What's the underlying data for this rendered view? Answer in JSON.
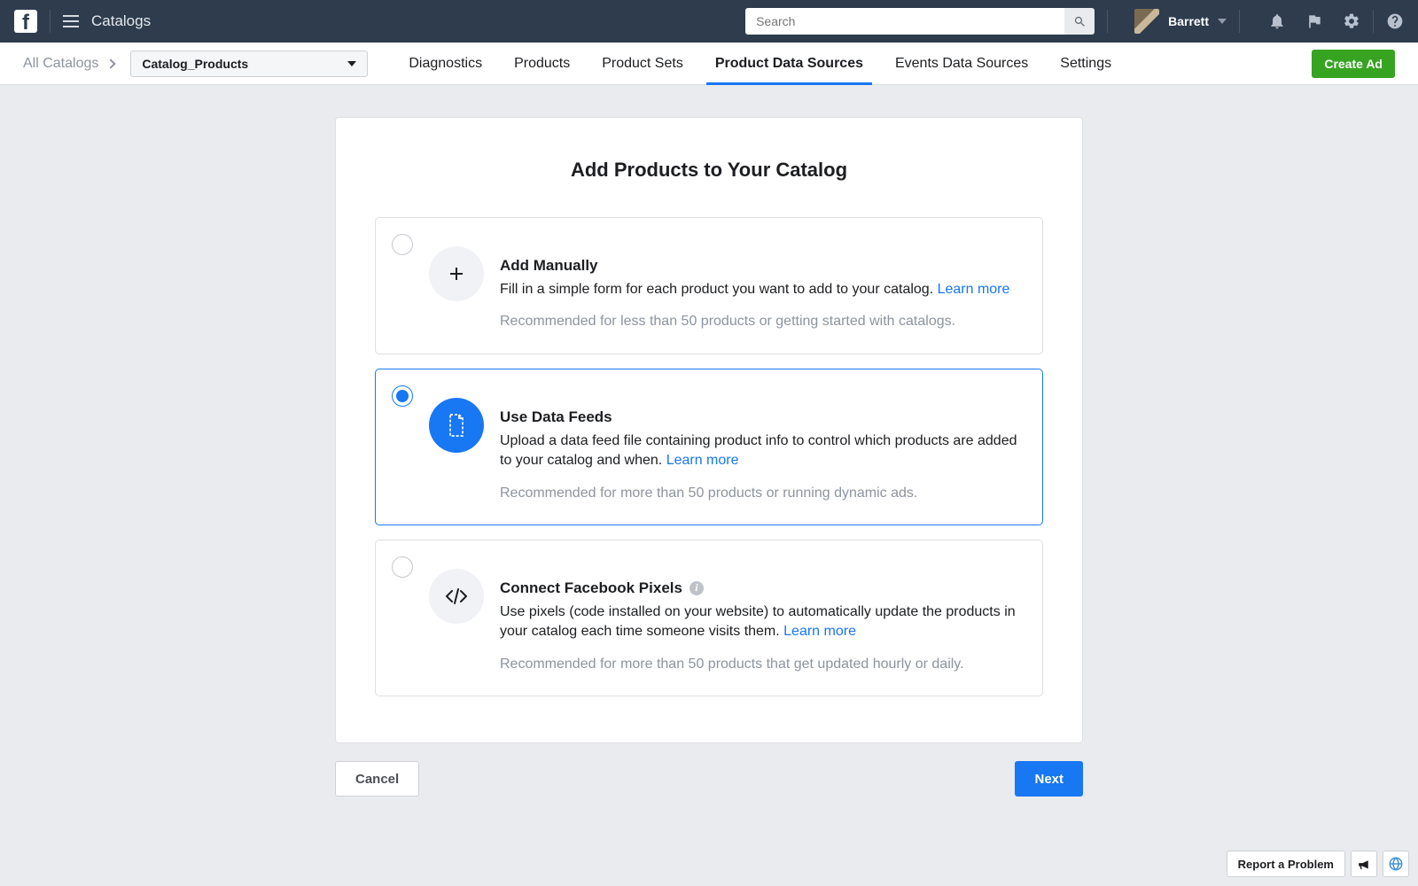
{
  "topbar": {
    "app_title": "Catalogs",
    "search_placeholder": "Search",
    "user_name": "Barrett"
  },
  "subnav": {
    "crumb": "All Catalogs",
    "catalog_selected": "Catalog_Products",
    "tabs": [
      "Diagnostics",
      "Products",
      "Product Sets",
      "Product Data Sources",
      "Events Data Sources",
      "Settings"
    ],
    "active_tab_index": 3,
    "create_ad": "Create Ad"
  },
  "panel": {
    "title": "Add Products to Your Catalog",
    "learn_more": "Learn more",
    "options": [
      {
        "title": "Add Manually",
        "desc": "Fill in a simple form for each product you want to add to your catalog. ",
        "rec": "Recommended for less than 50 products or getting started with catalogs.",
        "selected": false,
        "icon": "plus",
        "info": false
      },
      {
        "title": "Use Data Feeds",
        "desc": "Upload a data feed file containing product info to control which products are added to your catalog and when. ",
        "rec": "Recommended for more than 50 products or running dynamic ads.",
        "selected": true,
        "icon": "file",
        "info": false
      },
      {
        "title": "Connect Facebook Pixels",
        "desc": "Use pixels (code installed on your website) to automatically update the products in your catalog each time someone visits them. ",
        "rec": "Recommended for more than 50 products that get updated hourly or daily.",
        "selected": false,
        "icon": "code",
        "info": true
      }
    ]
  },
  "actions": {
    "cancel": "Cancel",
    "next": "Next"
  },
  "corner": {
    "report": "Report a Problem"
  }
}
